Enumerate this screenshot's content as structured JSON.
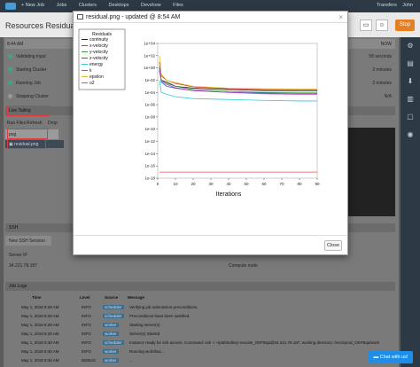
{
  "topbar": {
    "nav": [
      "+ New Job",
      "Jobs",
      "Clusters",
      "Desktops",
      "Devshow",
      "Files"
    ],
    "transfers": "Transfers",
    "user": "John"
  },
  "header": {
    "title": "Resources Residual",
    "stop_label": "Stop",
    "time": "8:44 AM",
    "status": "NOW"
  },
  "rows": [
    {
      "label": "Validating input",
      "value": "56 seconds"
    },
    {
      "label": "Starting Cluster",
      "value": "2 minutes"
    },
    {
      "label": "Running Job",
      "value": "2 minutes"
    },
    {
      "label": "Stopping Cluster",
      "value": "N/A"
    }
  ],
  "live_tailing": {
    "title": "Live Tailing",
    "tabs": [
      "Run Files",
      "Refresh",
      "Drop"
    ],
    "search_value": "png",
    "file": "residual.png"
  },
  "ssh": {
    "title": "SSH",
    "new_session": "New SSH Session",
    "server_ip_label": "Server IP",
    "server_ip": "34.221.78.187",
    "node_label": "Compute node"
  },
  "job_logs": {
    "title": "Job Logs",
    "columns": [
      "Time",
      "Level",
      "Source",
      "Message"
    ],
    "rows": [
      {
        "time": "May 1, 2018 8:28 AM",
        "level": "INFO",
        "source": "scheduler",
        "message": "Verifying job submission preconditions."
      },
      {
        "time": "May 1, 2018 8:28 AM",
        "level": "INFO",
        "source": "scheduler",
        "message": "Preconditions have been satisfied."
      },
      {
        "time": "May 1, 2018 8:29 AM",
        "level": "INFO",
        "source": "worker",
        "message": "Starting server(s)"
      },
      {
        "time": "May 1, 2018 8:30 AM",
        "level": "INFO",
        "source": "worker",
        "message": "Server(s) Started"
      },
      {
        "time": "May 1, 2018 8:30 AM",
        "level": "INFO",
        "source": "scheduler",
        "message": "Instance ready for ssh access. Command: ssh -i ~/path/to/key-rescale_OEFBqa@34.221.78.187, working directory: /enc/rprod_OEFBqa/work"
      },
      {
        "time": "May 1, 2018 8:30 AM",
        "level": "INFO",
        "source": "worker",
        "message": "Running workflow..."
      },
      {
        "time": "May 1, 2018 8:30 AM",
        "level": "DEBUG",
        "source": "worker",
        "message": "..."
      }
    ]
  },
  "chat": {
    "label": "Chat with us!"
  },
  "modal": {
    "title": "residual.png - updated @ 8:54 AM",
    "close_label": "Close"
  },
  "chart_data": {
    "type": "line",
    "title": "",
    "xlabel": "Iterations",
    "ylabel": "",
    "y_scale": "log",
    "xlim": [
      0,
      90
    ],
    "ylim": [
      1e-18,
      10000.0
    ],
    "x_ticks": [
      0,
      10,
      20,
      30,
      40,
      50,
      60,
      70,
      80,
      90
    ],
    "y_ticks": [
      "1e+04",
      "1e+02",
      "1e+00",
      "1e-02",
      "1e-04",
      "1e-06",
      "1e-08",
      "1e-10",
      "1e-12",
      "1e-14",
      "1e-16",
      "1e-18"
    ],
    "legend_title": "Residuals",
    "legend_position": "top-left",
    "series": [
      {
        "name": "continuity",
        "color": "#222222",
        "x": [
          1,
          2,
          5,
          10,
          20,
          40,
          60,
          80,
          90
        ],
        "y": [
          0.3,
          0.01,
          0.005,
          0.001,
          0.0005,
          0.0003,
          0.0002,
          0.0002,
          0.0002
        ]
      },
      {
        "name": "x-velocity",
        "color": "#e03030",
        "x": [
          1,
          2,
          5,
          10,
          20,
          40,
          60,
          80,
          90
        ],
        "y": [
          10.0,
          0.05,
          0.01,
          0.003,
          0.0008,
          0.0004,
          0.0003,
          0.0003,
          0.0003
        ]
      },
      {
        "name": "y-velocity",
        "color": "#3a9a3a",
        "x": [
          1,
          2,
          5,
          10,
          20,
          40,
          60,
          80,
          90
        ],
        "y": [
          2,
          0.01,
          0.003,
          0.001,
          0.0003,
          0.00015,
          0.0001,
          0.0001,
          0.0001
        ]
      },
      {
        "name": "z-velocity",
        "color": "#2b5cc8",
        "x": [
          1,
          2,
          5,
          10,
          20,
          40,
          60,
          80,
          90
        ],
        "y": [
          1,
          0.005,
          0.001,
          0.0005,
          0.0002,
          0.0001,
          8e-05,
          7e-05,
          7e-05
        ]
      },
      {
        "name": "energy",
        "color": "#30c8d8",
        "x": [
          1,
          2,
          5,
          10,
          20,
          40,
          60,
          80,
          90
        ],
        "y": [
          0.01,
          0.0001,
          5e-05,
          2e-05,
          1e-05,
          7e-06,
          5e-06,
          4e-06,
          4e-06
        ]
      },
      {
        "name": "k",
        "color": "#c040c0",
        "x": [
          1,
          2,
          5,
          10,
          20,
          40,
          60,
          80,
          90
        ],
        "y": [
          0.5,
          0.008,
          0.002,
          0.0006,
          0.0002,
          0.0001,
          6e-05,
          5e-05,
          5e-05
        ]
      },
      {
        "name": "epsilon",
        "color": "#d8c030",
        "x": [
          1,
          2,
          5,
          10,
          20,
          40,
          60,
          80,
          90
        ],
        "y": [
          100.0,
          0.1,
          0.01,
          0.004,
          0.001,
          0.0005,
          0.0004,
          0.00035,
          0.00035
        ]
      },
      {
        "name": "o2",
        "color": "#e05050",
        "x": [
          1,
          5,
          10,
          20,
          40,
          60,
          80,
          90
        ],
        "y": [
          1e-17,
          1e-17,
          1e-17,
          1e-17,
          1e-17,
          1e-17,
          1e-17,
          1e-17
        ]
      }
    ]
  }
}
